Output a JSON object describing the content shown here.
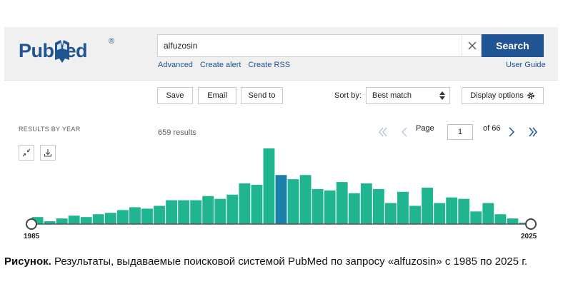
{
  "header": {
    "logo_text_left": "Pub",
    "logo_text_right": "ed",
    "logo_registered": "®",
    "search_value": "alfuzosin",
    "search_button": "Search",
    "links": [
      "Advanced",
      "Create alert",
      "Create RSS"
    ],
    "user_guide": "User Guide"
  },
  "toolbar": {
    "save": "Save",
    "email": "Email",
    "send_to": "Send to",
    "sort_label": "Sort by:",
    "sort_value": "Best match",
    "display_options": "Display options"
  },
  "results_bar": {
    "section_label": "RESULTS BY YEAR",
    "count": "659 results",
    "page_label": "Page",
    "page_value": "1",
    "of_pages": "of 66"
  },
  "icons": {
    "collapse": "collapse-icon",
    "download": "download-icon",
    "clear": "close-icon",
    "sort": "sort-arrows-icon",
    "gear": "gear-icon",
    "first": "double-chevron-left-icon",
    "prev": "chevron-left-icon",
    "next": "chevron-right-icon",
    "last": "double-chevron-right-icon"
  },
  "colors": {
    "brand": "#205493",
    "bar": "#1fb591",
    "bar_highlight": "#1a7fa8"
  },
  "chart_data": {
    "type": "bar",
    "x": [
      1985,
      1986,
      1987,
      1988,
      1989,
      1990,
      1991,
      1992,
      1993,
      1994,
      1995,
      1996,
      1997,
      1998,
      1999,
      2000,
      2001,
      2002,
      2003,
      2004,
      2005,
      2006,
      2007,
      2008,
      2009,
      2010,
      2011,
      2012,
      2013,
      2014,
      2015,
      2016,
      2017,
      2018,
      2019,
      2020,
      2021,
      2022,
      2023,
      2024,
      2025
    ],
    "values": [
      5,
      2,
      4,
      6,
      5,
      7,
      8,
      10,
      12,
      11,
      13,
      17,
      17,
      17,
      20,
      18,
      21,
      29,
      28,
      54,
      35,
      32,
      35,
      25,
      24,
      30,
      22,
      29,
      25,
      15,
      23,
      13,
      26,
      15,
      19,
      18,
      9,
      15,
      7,
      4,
      1
    ],
    "highlight_index": 20,
    "xrange_labels": [
      "1985",
      "2025"
    ],
    "ylim": [
      0,
      55
    ]
  },
  "caption": {
    "bold": "Рисунок.",
    "text": " Результаты, выдаваемые поисковой системой PubMed по запросу «alfuzosin» с 1985 по 2025 г."
  }
}
